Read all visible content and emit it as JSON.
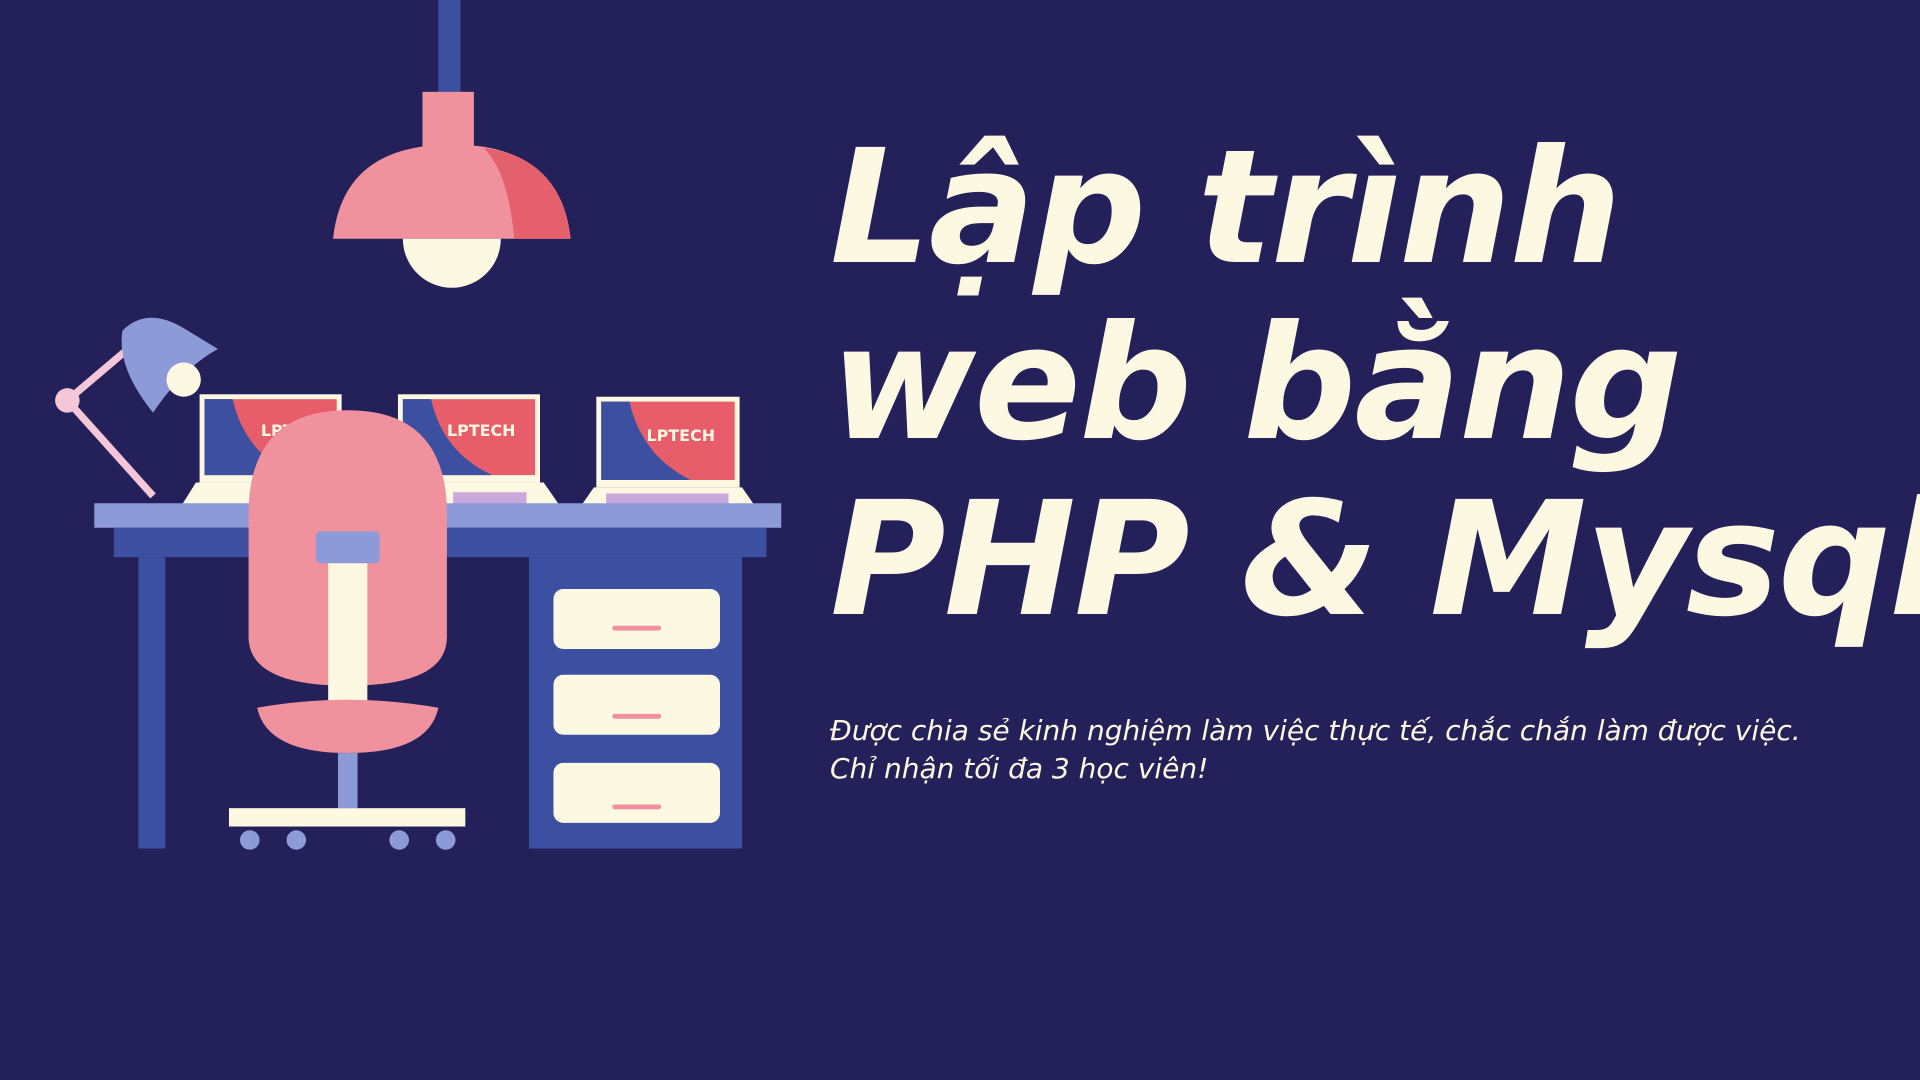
{
  "title": {
    "lines": [
      "Lập trình",
      "web bằng",
      "PHP & Mysql"
    ]
  },
  "subtitle": {
    "lines": [
      "Được chia sẻ kinh nghiệm làm việc thực tế, chắc chắn làm được việc.",
      "Chỉ nhận tối đa 3 học viên!"
    ]
  },
  "laptop_logo": {
    "brand": "LPTECH"
  },
  "colors": {
    "background": "#24215a",
    "text": "#fdf8e1",
    "pink": "#f0919e",
    "red": "#e85d6a",
    "blue": "#3d4fa0",
    "lavender": "#8d9ad8"
  }
}
